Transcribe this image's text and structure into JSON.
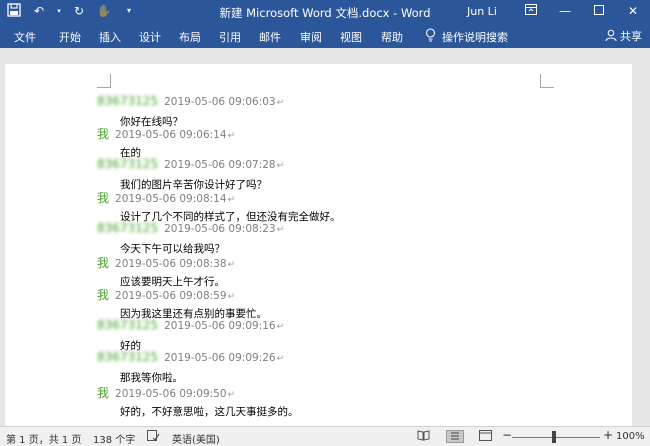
{
  "window": {
    "title": "新建 Microsoft Word 文档.docx  -  Word",
    "user": "Jun Li"
  },
  "icons": {
    "save": "save-icon",
    "undo": "undo-icon",
    "redo": "redo-icon",
    "touch": "touch-mode-icon",
    "customize": "customize-qat-icon",
    "ribbon_display": "ribbon-display-options-icon",
    "minimize": "minimize-icon",
    "maximize": "maximize-icon",
    "close": "close-icon",
    "lightbulb": "lightbulb-icon",
    "person": "person-icon"
  },
  "ribbon": {
    "tabs": [
      "文件",
      "开始",
      "插入",
      "设计",
      "布局",
      "引用",
      "邮件",
      "审阅",
      "视图",
      "帮助"
    ],
    "tell_me": "操作说明搜索",
    "share": "共享"
  },
  "messages": [
    {
      "sender": "83673125",
      "time": "2019-05-06 09:06:03",
      "text": "你好在线吗？"
    },
    {
      "sender": "我",
      "time": "2019-05-06 09:06:14",
      "text": "在的"
    },
    {
      "sender": "83673125",
      "time": "2019-05-06 09:07:28",
      "text": "我们的图片辛苦你设计好了吗？"
    },
    {
      "sender": "我",
      "time": "2019-05-06 09:08:14",
      "text": "设计了几个不同的样式了，但还没有完全做好。"
    },
    {
      "sender": "83673125",
      "time": "2019-05-06 09:08:23",
      "text": "今天下午可以给我吗？"
    },
    {
      "sender": "我",
      "time": "2019-05-06 09:08:38",
      "text": "应该要明天上午才行。"
    },
    {
      "sender": "我",
      "time": "2019-05-06 09:08:59",
      "text": "因为我这里还有点别的事要忙。"
    },
    {
      "sender": "83673125",
      "time": "2019-05-06 09:09:16",
      "text": "好的"
    },
    {
      "sender": "83673125",
      "time": "2019-05-06 09:09:26",
      "text": "那我等你啦。"
    },
    {
      "sender": "我",
      "time": "2019-05-06 09:09:50",
      "text": "好的，不好意思啦，这几天事挺多的。"
    }
  ],
  "status": {
    "page": "第 1 页，共 1 页",
    "words": "138 个字",
    "language": "英语(美国)",
    "zoom": "100%",
    "zoom_minus": "−",
    "zoom_plus": "+"
  },
  "colors": {
    "ribbon": "#2b579a",
    "sender": "#4aa329",
    "timestamp": "#808080"
  }
}
